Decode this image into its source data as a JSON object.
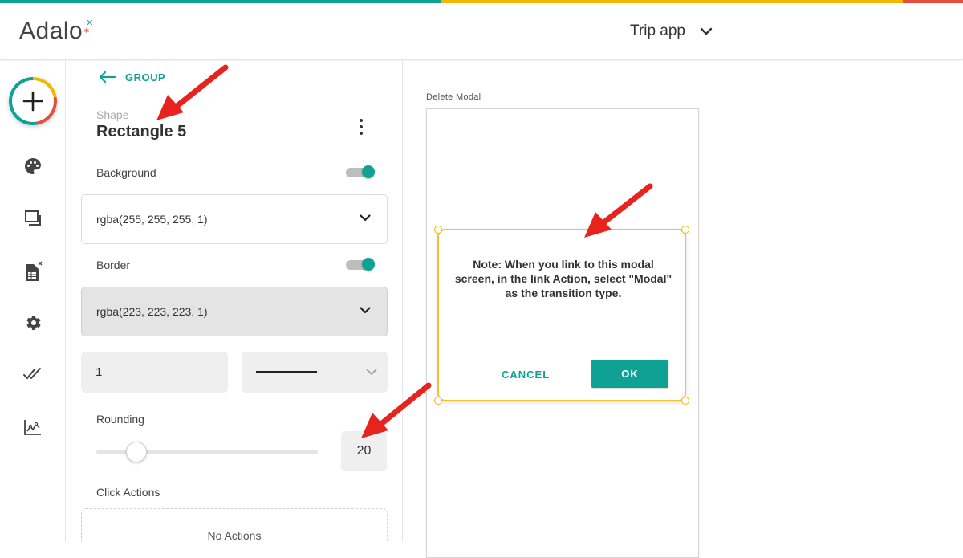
{
  "colors": {
    "stripe_teal": "#0fa294",
    "stripe_yellow": "#f2b705",
    "stripe_red": "#e94e3c",
    "accent": "#0fa294",
    "annotation_arrow": "#e8231d",
    "selection": "#f2c230"
  },
  "header": {
    "logo_text": "Adalo",
    "project_name": "Trip app",
    "project_dropdown_icon": "chevron-down-icon"
  },
  "left_rail": {
    "items": [
      {
        "name": "add-component",
        "icon": "plus-icon"
      },
      {
        "name": "branding",
        "icon": "palette-icon"
      },
      {
        "name": "screens",
        "icon": "screens-icon"
      },
      {
        "name": "database",
        "icon": "database-icon"
      },
      {
        "name": "settings",
        "icon": "gear-icon"
      },
      {
        "name": "publish",
        "icon": "double-check-icon"
      },
      {
        "name": "analytics",
        "icon": "analytics-icon"
      }
    ]
  },
  "panel": {
    "back_label": "GROUP",
    "shape_label": "Shape",
    "shape_name": "Rectangle 5",
    "background": {
      "label": "Background",
      "enabled": true,
      "value": "rgba(255, 255, 255, 1)"
    },
    "border": {
      "label": "Border",
      "enabled": true,
      "value": "rgba(223, 223, 223, 1)",
      "width": "1",
      "style": "solid"
    },
    "rounding": {
      "label": "Rounding",
      "value": "20",
      "slider_fraction": 0.18
    },
    "click_actions": {
      "label": "Click Actions",
      "empty_text": "No Actions"
    }
  },
  "canvas": {
    "screen_label": "Delete Modal",
    "modal": {
      "note": "Note: When you link to this modal screen, in the link Action, select \"Modal\" as the transition type.",
      "cancel_label": "CANCEL",
      "ok_label": "OK"
    }
  }
}
